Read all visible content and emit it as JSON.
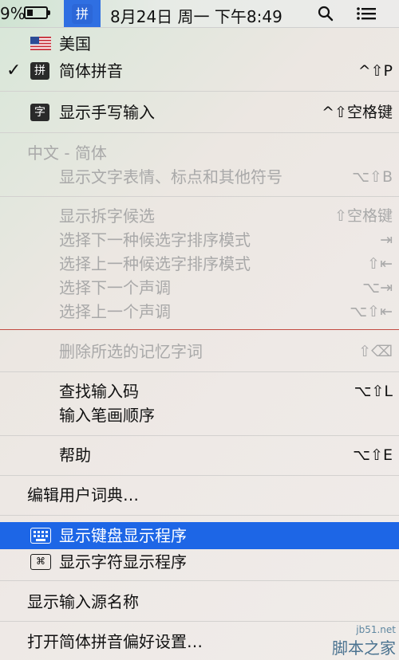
{
  "menubar": {
    "battery_percent": "9%",
    "battery_level": 0.3,
    "input_method_icon": "拼",
    "datetime": "8月24日 周一 下午8:49",
    "icons": [
      "battery-icon",
      "input-method-icon",
      "search-icon",
      "list-icon"
    ]
  },
  "menu": {
    "input_sources": [
      {
        "icon": "us-flag-icon",
        "label": "美国",
        "checked": false
      },
      {
        "icon": "pinyin-badge-icon",
        "badge": "拼",
        "label": "简体拼音",
        "checked": true,
        "check_mark": "✓",
        "shortcut": "^⇧P"
      }
    ],
    "handwriting": {
      "badge": "字",
      "label": "显示手写输入",
      "shortcut": "^⇧空格键"
    },
    "section_header": "中文 - 简体",
    "emoji": {
      "label": "显示文字表情、标点和其他符号",
      "shortcut": "⌥⇧B"
    },
    "candidates": [
      {
        "label": "显示拆字候选",
        "shortcut": "⇧空格键"
      },
      {
        "label": "选择下一种候选字排序模式",
        "shortcut": "⇥"
      },
      {
        "label": "选择上一种候选字排序模式",
        "shortcut": "⇧⇤"
      },
      {
        "label": "选择下一个声调",
        "shortcut": "⌥⇥"
      },
      {
        "label": "选择上一个声调",
        "shortcut": "⌥⇧⇤"
      }
    ],
    "delete_memory": {
      "label": "删除所选的记忆字词",
      "shortcut": "⇧⌫"
    },
    "lookup": {
      "label": "查找输入码",
      "shortcut": "⌥⇧L"
    },
    "stroke_order": {
      "label": "输入笔画顺序"
    },
    "help": {
      "label": "帮助",
      "shortcut": "⌥⇧E"
    },
    "edit_dict": {
      "label": "编辑用户词典…"
    },
    "keyboard_viewer": {
      "label": "显示键盘显示程序",
      "highlighted": true
    },
    "character_viewer": {
      "label": "显示字符显示程序"
    },
    "show_name": {
      "label": "显示输入源名称"
    },
    "preferences": {
      "label": "打开简体拼音偏好设置…"
    }
  },
  "watermark": {
    "url": "jb51.net",
    "brand": "脚本之家"
  },
  "colors": {
    "highlight": "#1d66e6",
    "dim_text": "#a9a9a9",
    "red_line": "#c24b42",
    "im_icon": "#2c67d8"
  }
}
